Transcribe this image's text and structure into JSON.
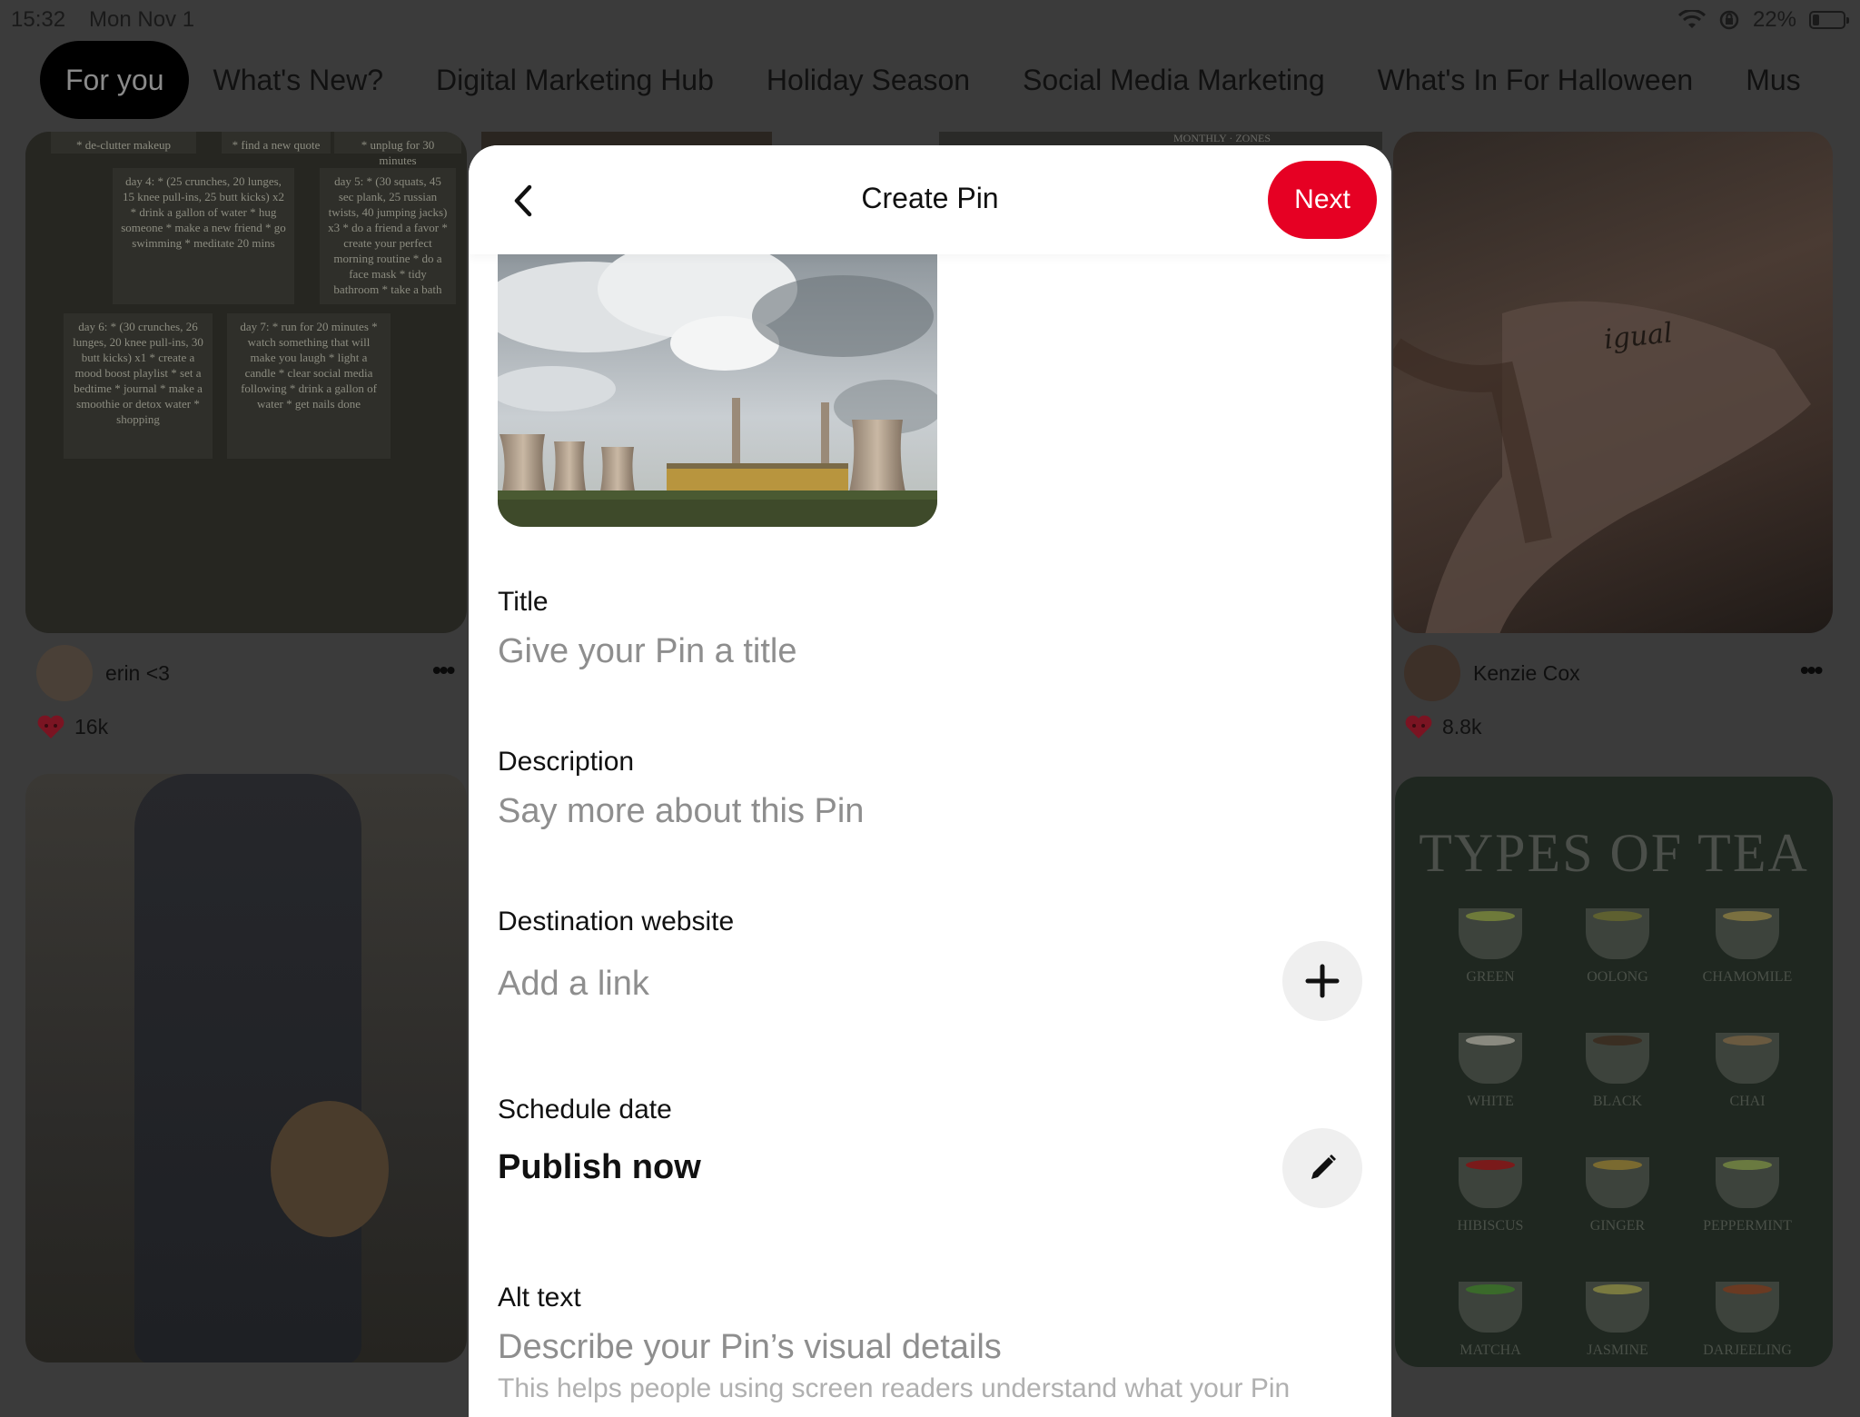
{
  "status_bar": {
    "time": "15:32",
    "date": "Mon Nov 1",
    "battery": "22%",
    "battery_level": 0.22
  },
  "tabs": [
    {
      "label": "For you",
      "active": true
    },
    {
      "label": "What's New?"
    },
    {
      "label": "Digital Marketing Hub"
    },
    {
      "label": "Holiday Season"
    },
    {
      "label": "Social Media Marketing"
    },
    {
      "label": "What's In For Halloween"
    },
    {
      "label": "Mus"
    }
  ],
  "feed": {
    "pin1": {
      "author": "erin <3",
      "likes": "16k"
    },
    "pin2": {
      "author": "Kenzie Cox",
      "likes": "8.8k"
    },
    "planner_notes": [
      "* de-clutter makeup",
      "* find a new quote",
      "* unplug for 30 minutes",
      "day 4: * (25 crunches, 20 lunges, 15 knee pull-ins, 25 butt kicks) x2 * drink a gallon of water * hug someone * make a new friend * go swimming * meditate 20 mins",
      "day 5: * (30 squats, 45 sec plank, 25 russian twists, 40 jumping jacks) x3 * do a friend a favor * create your perfect morning routine * do a face mask * tidy bathroom * take a bath",
      "day 6: * (30 crunches, 26 lunges, 20 knee pull-ins, 30 butt kicks) x1 * create a mood boost playlist * set a bedtime * journal * make a smoothie or detox water * shopping",
      "day 7: * run for 20 minutes * watch something that will make you laugh * light a candle * clear social media following * drink a gallon of water * get nails done"
    ],
    "calendar_label": "MONTHLY · ZONES",
    "tattoo_text": "igual",
    "tea_title": "TYPES OF TEA",
    "tea_types": [
      "GREEN",
      "OOLONG",
      "CHAMOMILE",
      "WHITE",
      "BLACK",
      "CHAI",
      "HIBISCUS",
      "GINGER",
      "PEPPERMINT",
      "MATCHA",
      "JASMINE",
      "DARJEELING"
    ]
  },
  "modal": {
    "title": "Create Pin",
    "next_label": "Next",
    "fields": {
      "title": {
        "label": "Title",
        "placeholder": "Give your Pin a title"
      },
      "description": {
        "label": "Description",
        "placeholder": "Say more about this Pin"
      },
      "website": {
        "label": "Destination website",
        "placeholder": "Add a link"
      },
      "schedule": {
        "label": "Schedule date",
        "value": "Publish now"
      },
      "alt_text": {
        "label": "Alt text",
        "placeholder": "Describe your Pin’s visual details",
        "helper": "This helps people using screen readers understand what your Pin"
      }
    }
  },
  "colors": {
    "accent": "#e60023",
    "overlay": "#3b3b3b"
  },
  "icons": [
    "back-chevron-icon",
    "plus-icon",
    "pencil-icon",
    "wifi-icon",
    "lock-rotation-icon",
    "battery-icon",
    "heart-icon",
    "more-dots-icon"
  ]
}
